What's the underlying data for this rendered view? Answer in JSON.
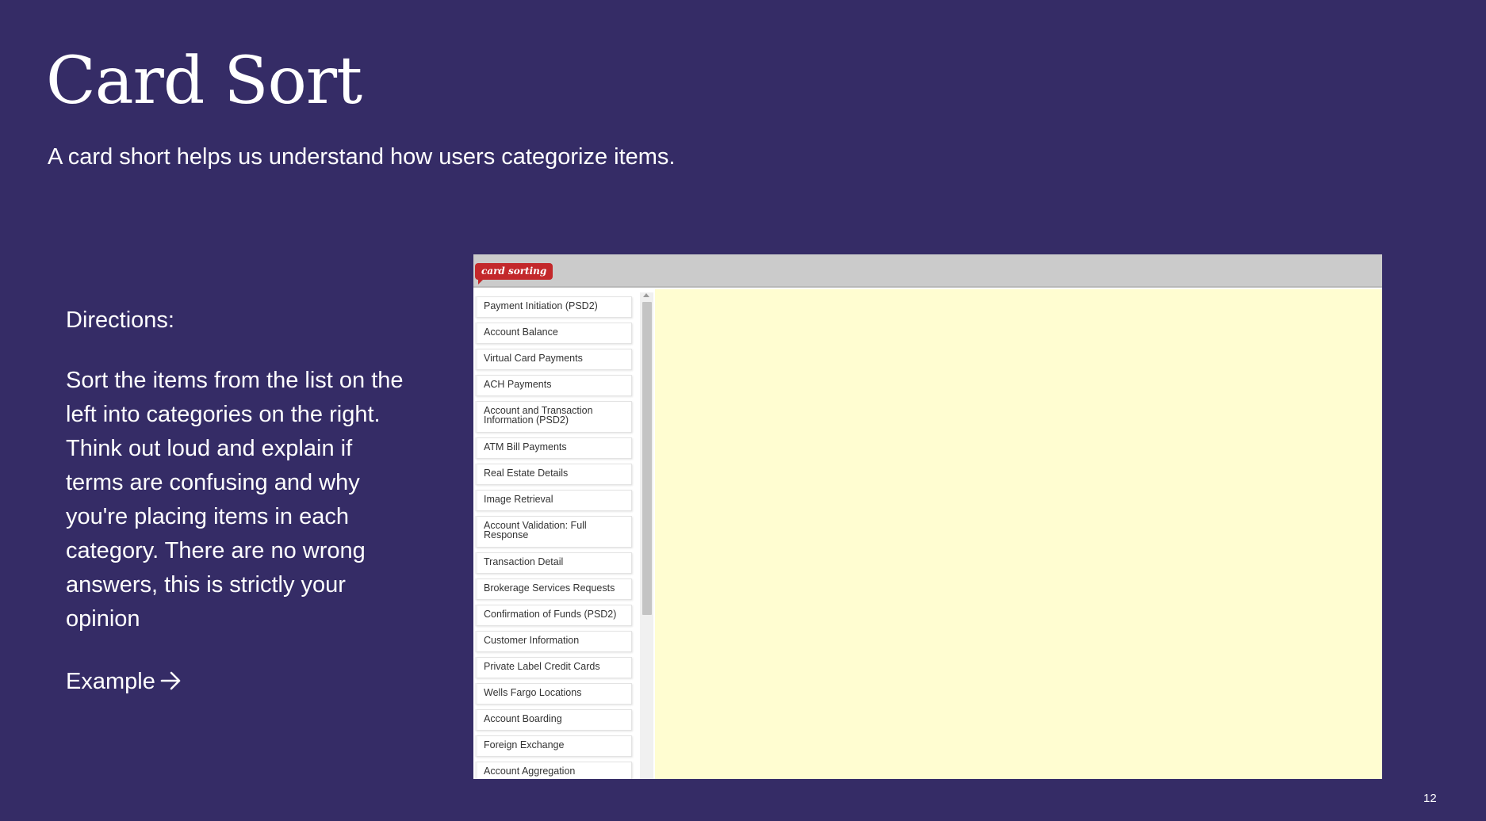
{
  "slide": {
    "title": "Card Sort",
    "subtitle": "A card short helps us understand how users categorize items.",
    "directions_heading": "Directions:",
    "directions_body": "Sort the items from the list on the left into categories on the right. Think out loud and explain if terms are confusing and why you're placing items in each category. There are no wrong answers, this is strictly your opinion",
    "example_label": "Example",
    "example_icon": "arrow-right-icon",
    "page_number": "12"
  },
  "card_app": {
    "logo_text": "card sorting",
    "cards": [
      "Payment Initiation (PSD2)",
      "Account Balance",
      "Virtual Card Payments",
      "ACH Payments",
      "Account and Transaction Information (PSD2)",
      "ATM Bill Payments",
      "Real Estate Details",
      "Image Retrieval",
      "Account Validation: Full Response",
      "Transaction Detail",
      "Brokerage Services Requests",
      "Confirmation of Funds (PSD2)",
      "Customer Information",
      "Private Label Credit Cards",
      "Wells Fargo Locations",
      "Account Boarding",
      "Foreign Exchange",
      "Account Aggregation"
    ],
    "colors": {
      "logo": "#c3282b",
      "drop_area": "#fffdd1",
      "header": "#cbcbcb"
    }
  },
  "colors": {
    "background": "#352c66",
    "text": "#ffffff"
  }
}
